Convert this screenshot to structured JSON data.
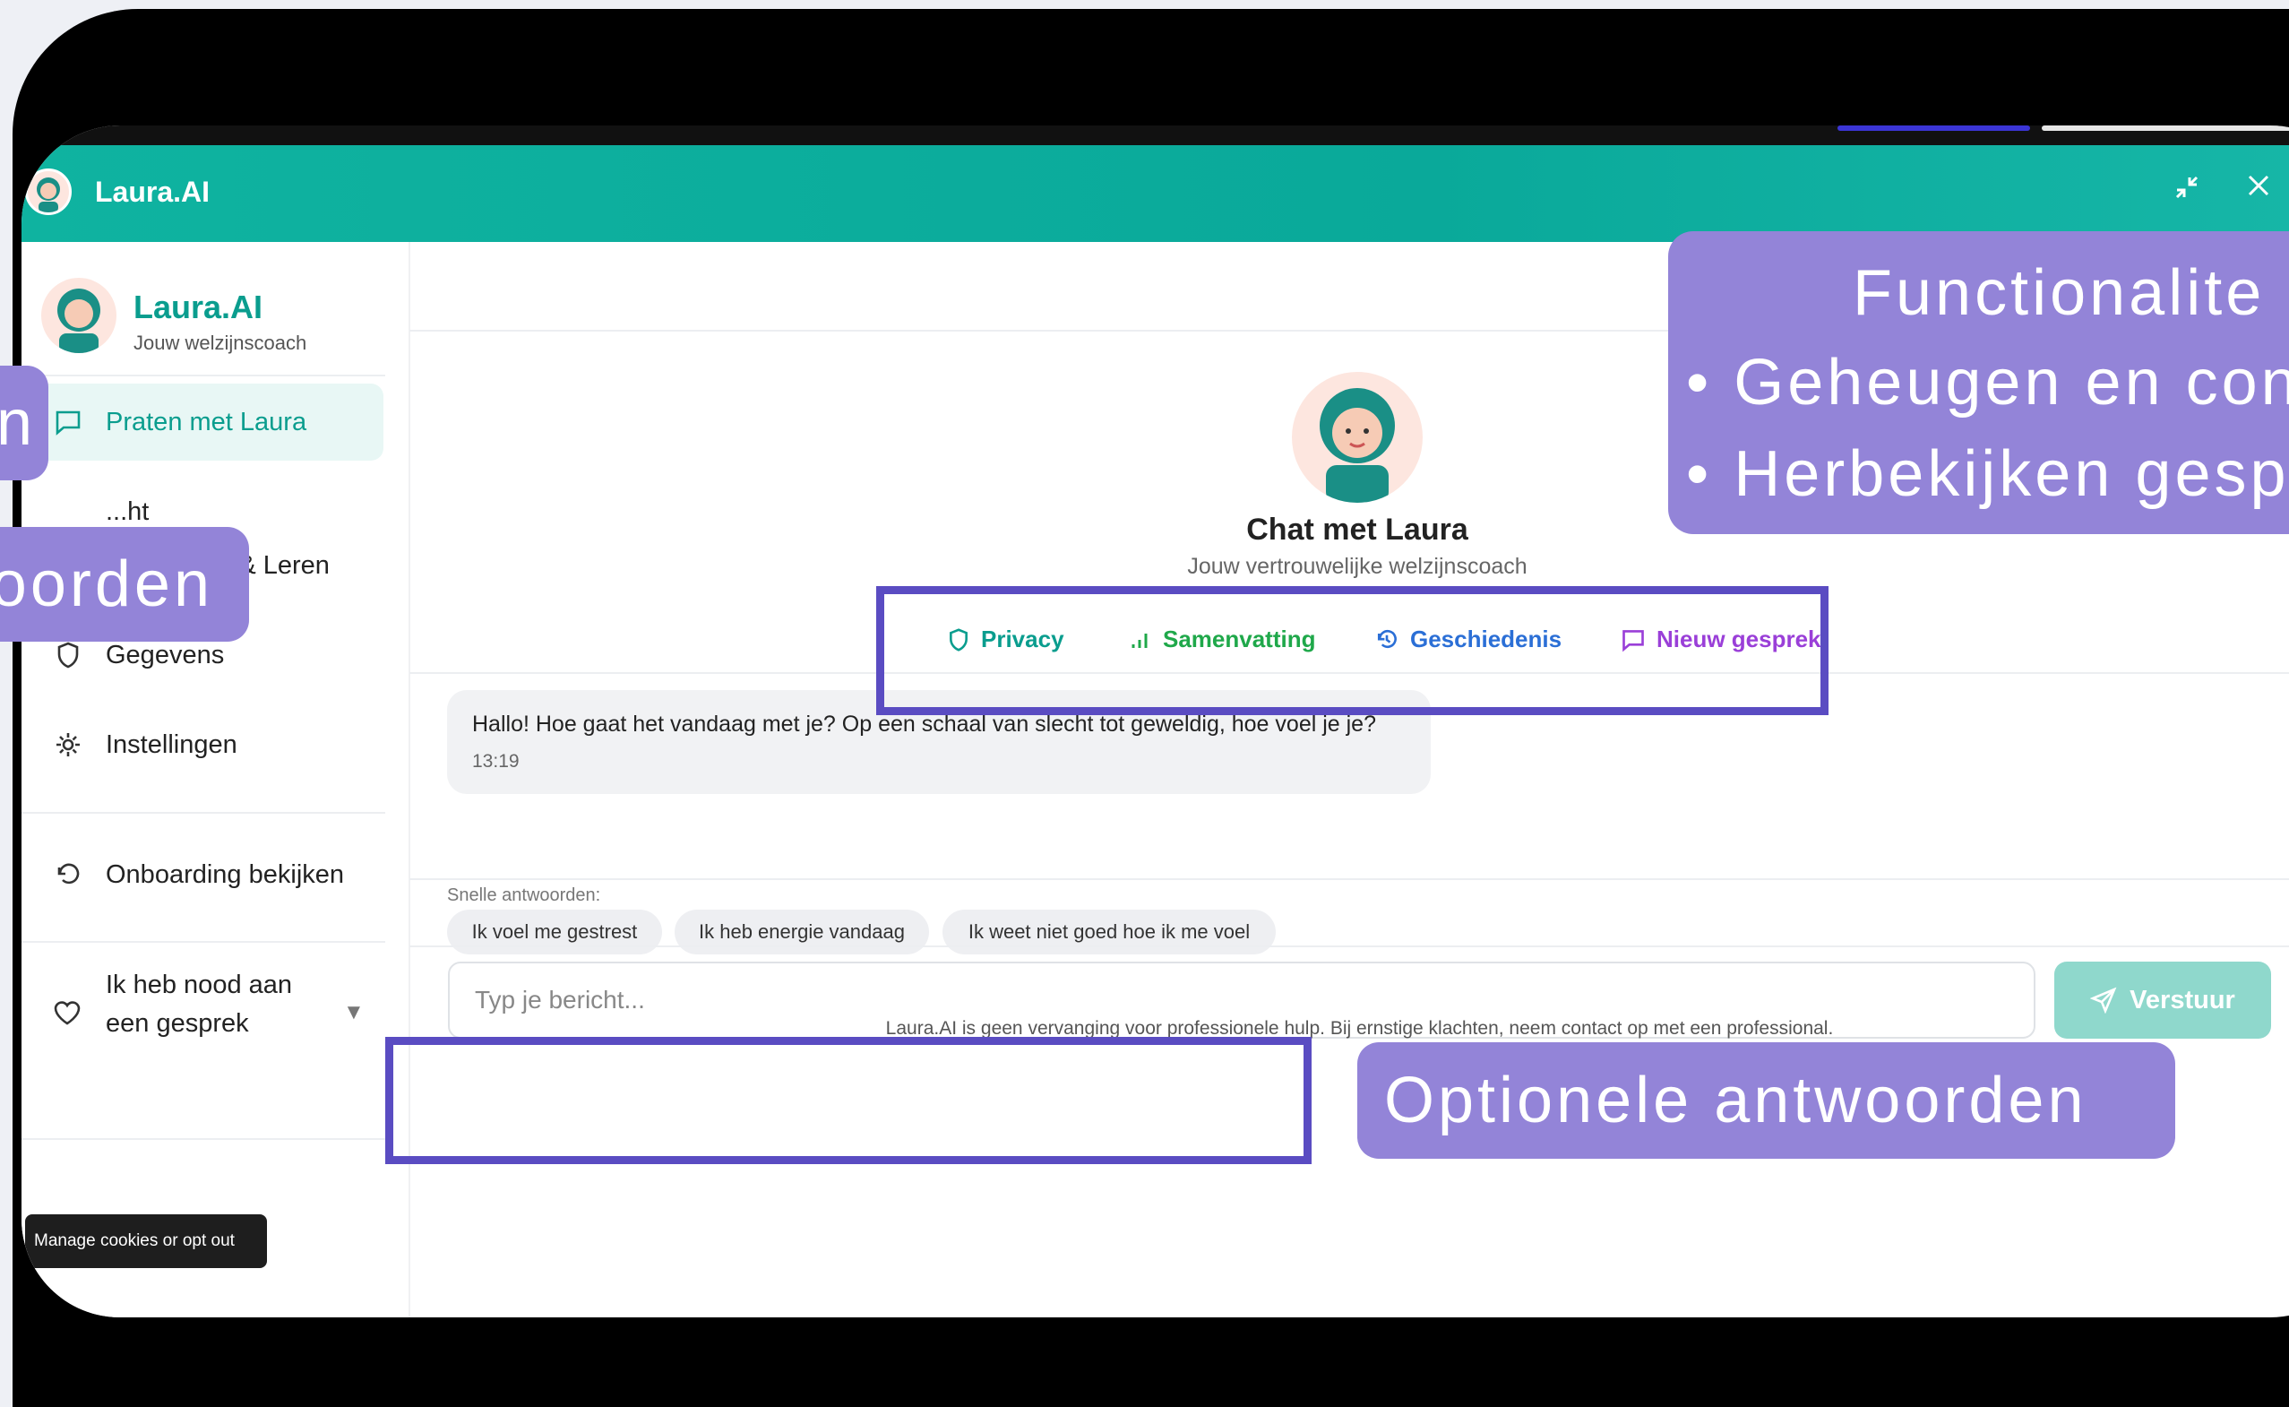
{
  "window": {
    "title": "Laura.AI"
  },
  "sidebar": {
    "brand_name": "Laura.AI",
    "brand_subtitle": "Jouw welzijnscoach",
    "items": [
      {
        "label": "Praten met Laura",
        "icon": "chat-icon",
        "active": true
      },
      {
        "label": "...ht",
        "icon": "chart-icon"
      },
      {
        "label": "Ontdekken & Leren",
        "icon": "bulb-icon"
      },
      {
        "label": "Gegevens",
        "icon": "shield-icon"
      },
      {
        "label": "Instellingen",
        "icon": "gear-icon"
      }
    ],
    "onboarding_label": "Onboarding bekijken",
    "help_label": "Ik heb nood aan een gesprek",
    "cookie_label": "Manage cookies or opt out"
  },
  "chat": {
    "title": "Chat met Laura",
    "subtitle": "Jouw vertrouwelijke welzijnscoach",
    "actions": [
      {
        "label": "Privacy",
        "color": "#0a9d8e",
        "icon": "shield-icon"
      },
      {
        "label": "Samenvatting",
        "color": "#1fa84a",
        "icon": "bar-chart-icon"
      },
      {
        "label": "Geschiedenis",
        "color": "#2b6fd6",
        "icon": "history-icon"
      },
      {
        "label": "Nieuw gesprek",
        "color": "#9a3fd8",
        "icon": "chat-icon"
      }
    ],
    "message": {
      "text": "Hallo! Hoe gaat het vandaag met je? Op een schaal van slecht tot geweldig, hoe voel je je?",
      "time": "13:19"
    },
    "quick_label": "Snelle antwoorden:",
    "quick_replies": [
      "Ik voel me gestrest",
      "Ik heb energie vandaag",
      "Ik weet niet goed hoe ik me voel"
    ],
    "input_placeholder": "Typ je bericht...",
    "send_label": "Verstuur",
    "disclaimer": "Laura.AI is geen vervanging voor professionele hulp. Bij ernstige klachten, neem contact op met een professional."
  },
  "annotations": {
    "left_top": "n",
    "left_mid": "oorden",
    "right_title": "Functionalite",
    "right_bullet1": "• Geheugen en con",
    "right_bullet2": "• Herbekijken gesp",
    "bottom": "Optionele antwoorden"
  },
  "colors": {
    "accent": "#0aa99a",
    "annotation": "#9384d8",
    "highlight": "#5a4cc2"
  }
}
